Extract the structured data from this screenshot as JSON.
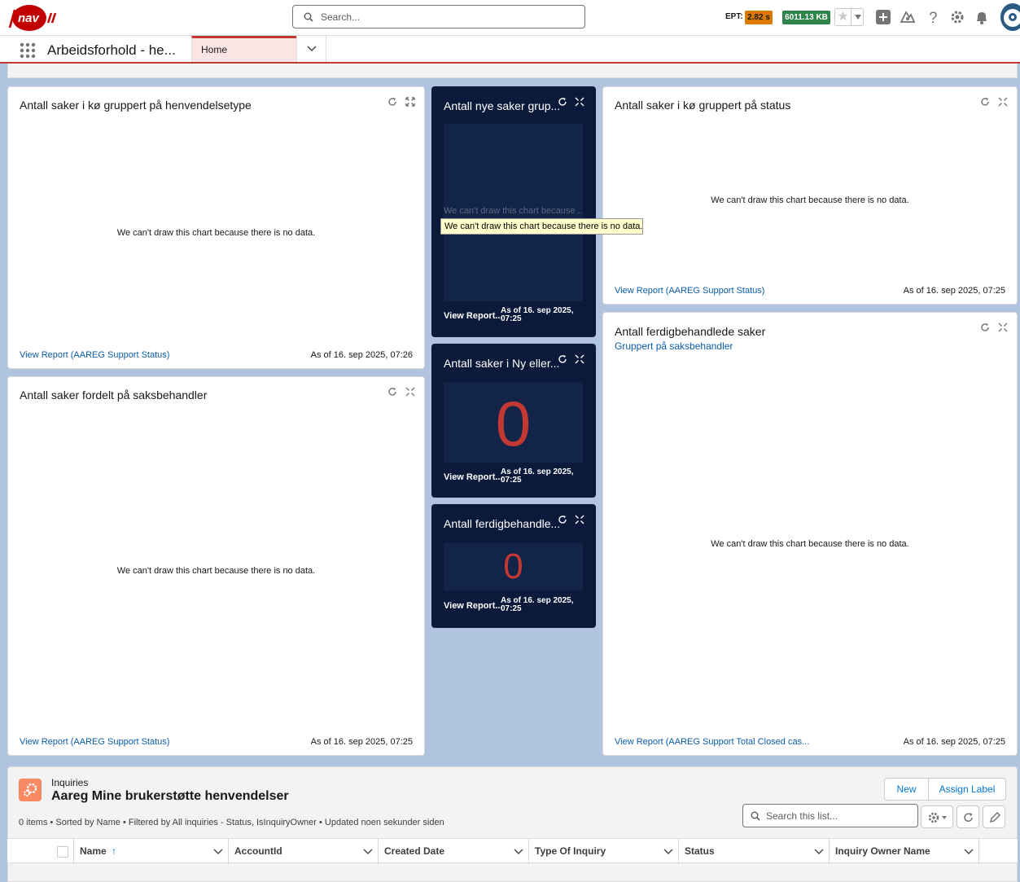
{
  "header": {
    "brand": "nav",
    "search_placeholder": "Search...",
    "ept_label": "EPT:",
    "ept_value": "2.82 s",
    "kb_value": "6011.13 KB"
  },
  "nav": {
    "app_name": "Arbeidsforhold - he...",
    "tabs": [
      {
        "label": "Home"
      }
    ]
  },
  "cards": {
    "henvendelsetype": {
      "title": "Antall saker i kø gruppert på henvendelsetype",
      "nodata": "We can't draw this chart because there is no data.",
      "view_report": "View Report (AAREG Support Status)",
      "as_of": "As of 16. sep 2025, 07:26"
    },
    "saksbehandler": {
      "title": "Antall saker fordelt på saksbehandler",
      "nodata": "We can't draw this chart because there is no data.",
      "view_report": "View Report (AAREG Support Status)",
      "as_of": "As of 16. sep 2025, 07:25"
    },
    "nye_saker": {
      "title": "Antall nye saker grup...",
      "nodata": "We can't draw this chart because ...",
      "view_report": "View Report...",
      "as_of": "As of 16. sep 2025, 07:25"
    },
    "ny_eller": {
      "title": "Antall saker i Ny eller...",
      "value": "0",
      "view_report": "View Report...",
      "as_of": "As of 16. sep 2025, 07:25"
    },
    "ferdig_small": {
      "title": "Antall ferdigbehandle...",
      "value": "0",
      "view_report": "View Report...",
      "as_of": "As of 16. sep 2025, 07:25"
    },
    "status": {
      "title": "Antall saker i kø gruppert på status",
      "nodata": "We can't draw this chart because there is no data.",
      "view_report": "View Report (AAREG Support Status)",
      "as_of": "As of 16. sep 2025, 07:25"
    },
    "ferdigbehandlede": {
      "title": "Antall ferdigbehandlede saker",
      "subtitle": "Gruppert på saksbehandler",
      "nodata": "We can't draw this chart because there is no data.",
      "view_report": "View Report (AAREG Support Total Closed cas...",
      "as_of": "As of 16. sep 2025, 07:25"
    }
  },
  "tooltip": "We can't draw this chart because there is no data.",
  "list": {
    "object": "Inquiries",
    "title": "Aareg Mine brukerstøtte henvendelser",
    "meta": "0 items • Sorted by Name • Filtered by All inquiries - Status, IsInquiryOwner • Updated noen sekunder siden",
    "new_label": "New",
    "assign_label": "Assign Label",
    "search_placeholder": "Search this list...",
    "columns": [
      "Name",
      "AccountId",
      "Created Date",
      "Type Of Inquiry",
      "Status",
      "Inquiry Owner Name"
    ],
    "sort_indicator": "↑"
  },
  "colors": {
    "brand_red": "#c23934",
    "dark_card": "#0b1a3a",
    "link": "#0b5cab",
    "ept_badge": "#dd7a01",
    "kb_badge": "#2e844a"
  }
}
